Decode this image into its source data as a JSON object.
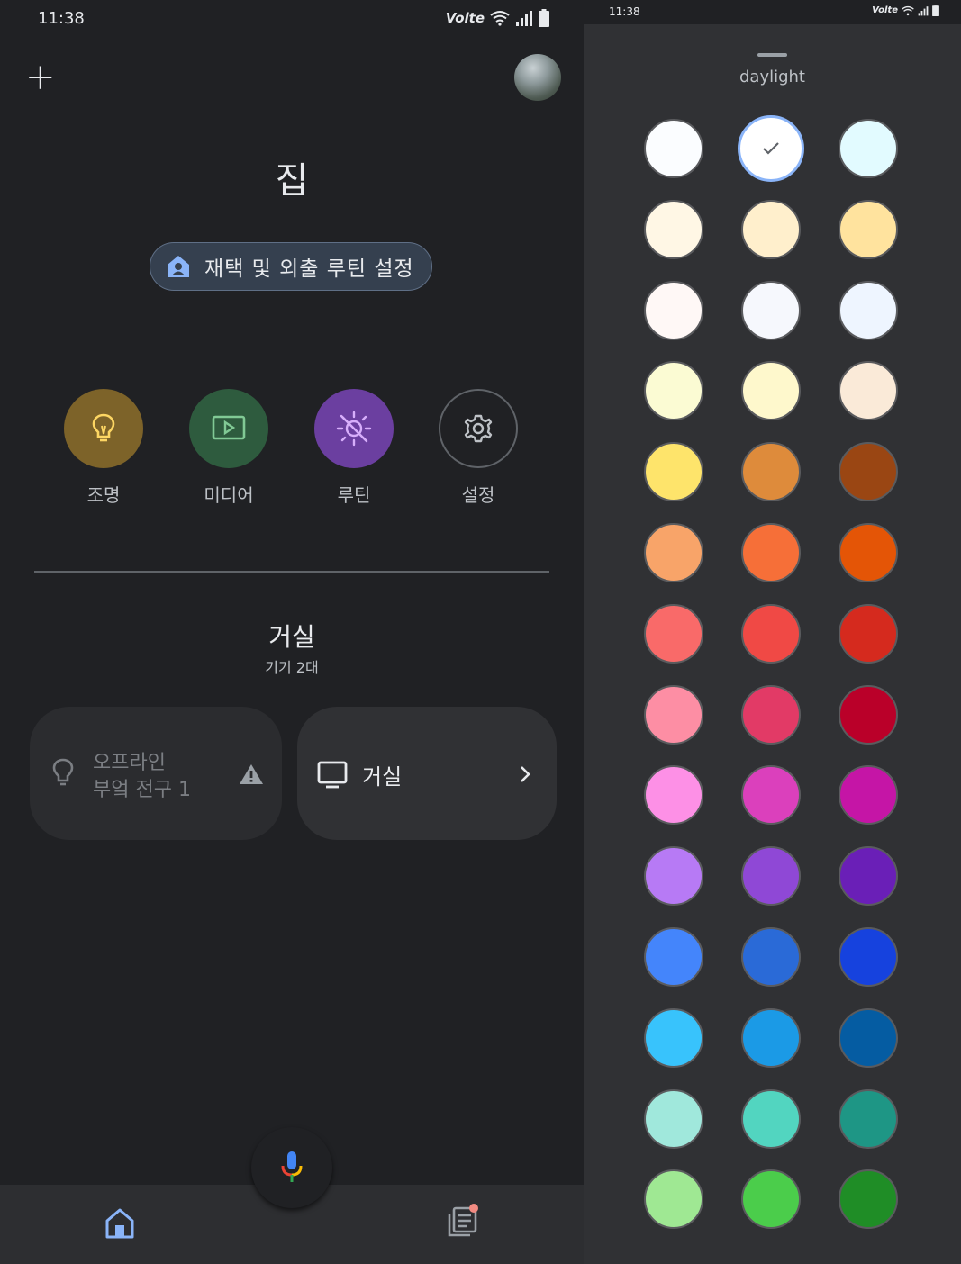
{
  "left": {
    "status": {
      "time": "11:38",
      "signal_text": "Volte"
    },
    "header": {
      "add_icon": "plus-icon",
      "avatar_icon": "profile-avatar"
    },
    "home_title": "집",
    "routine_pill": {
      "label": "재택 및 외출 루틴 설정",
      "icon": "home-person-icon",
      "color": "#35404f"
    },
    "favorites": [
      {
        "label": "조명",
        "icon": "lightbulb-icon",
        "bg": "#7d6329",
        "fg": "#fdd663"
      },
      {
        "label": "미디어",
        "icon": "play-screen-icon",
        "bg": "#2e5b3e",
        "fg": "#81c995"
      },
      {
        "label": "루틴",
        "icon": "sun-off-icon",
        "bg": "#6b3fa0",
        "fg": "#d7aefb"
      },
      {
        "label": "설정",
        "icon": "gear-icon",
        "bg": "#202124",
        "fg": "#bdc1c6"
      }
    ],
    "room": {
      "title": "거실",
      "subtitle": "기기 2대"
    },
    "devices": [
      {
        "status": "오프라인",
        "name": "부엌 전구 1",
        "icon": "lightbulb-outline-icon",
        "warning_icon": "warning-icon"
      },
      {
        "name": "거실",
        "icon": "tv-icon",
        "chevron_icon": "chevron-right-icon"
      }
    ],
    "fab": {
      "icon": "mic-icon"
    },
    "bottom_nav": {
      "home_icon": "home-icon",
      "feed_icon": "feed-icon",
      "badge_color": "#f28b82",
      "accent": "#8ab4f8"
    }
  },
  "right": {
    "status": {
      "time": "11:38",
      "signal_text": "Volte"
    },
    "title": "daylight",
    "selected_index": 1,
    "swatches": [
      "#fbfdff",
      "#ffffff",
      "#e2fbff",
      "#fff7e5",
      "#ffefcc",
      "#ffe39e",
      "#fff8f6",
      "#f6f8fd",
      "#eef5ff",
      "#fbfbd3",
      "#fef8cc",
      "#faead8",
      "#fee46b",
      "#de8b3b",
      "#9a4613",
      "#f8a469",
      "#f66f38",
      "#e45506",
      "#f96a69",
      "#f04945",
      "#d52a1e",
      "#fd8ea4",
      "#e23a66",
      "#ba0029",
      "#fd90e6",
      "#db40bc",
      "#c515a6",
      "#b77af5",
      "#8f48d6",
      "#6a1fb7",
      "#4485fb",
      "#2a6ad7",
      "#1642de",
      "#38c3fc",
      "#1b9ae6",
      "#055ca2",
      "#a0e8dc",
      "#52d5c0",
      "#1e9685",
      "#9fe893",
      "#4bcd4b",
      "#1f8d26"
    ]
  }
}
